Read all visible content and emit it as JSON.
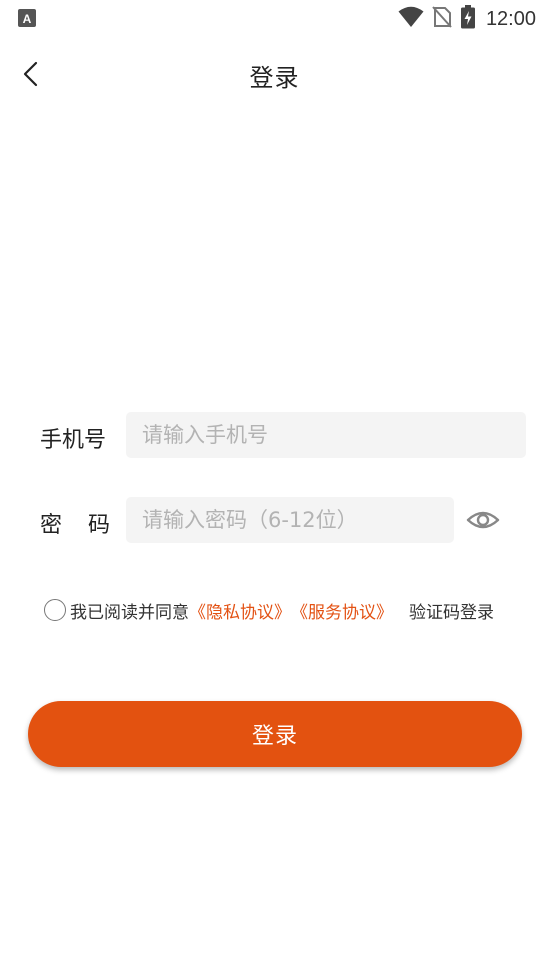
{
  "status_bar": {
    "time": "12:00",
    "left_icon": "a-notification-icon",
    "icons": [
      "wifi-icon",
      "no-sim-icon",
      "battery-charging-icon"
    ]
  },
  "header": {
    "title": "登录",
    "back_icon": "chevron-left-icon"
  },
  "form": {
    "phone_label": "手机号",
    "phone_placeholder": "请输入手机号",
    "phone_value": "",
    "password_label": "密码",
    "password_placeholder": "请输入密码（6-12位）",
    "password_value": "",
    "eye_icon": "eye-icon"
  },
  "agreement": {
    "prefix": "我已阅读并同意",
    "privacy_link": "《隐私协议》",
    "service_link": "《服务协议》",
    "sms_login": "验证码登录"
  },
  "login_button": {
    "label": "登录"
  },
  "colors": {
    "accent": "#e35210",
    "link": "#e35214",
    "input_bg": "#f4f4f4",
    "placeholder": "#b3b3b3"
  }
}
